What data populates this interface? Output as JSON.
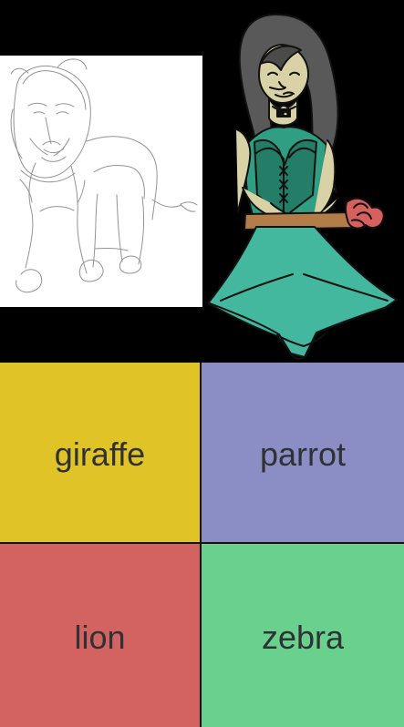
{
  "colors": {
    "background": "#000000",
    "yellow": "#e0c427",
    "purple": "#8b8ec4",
    "red": "#d36360",
    "green": "#69d18d",
    "text": "#2f3135"
  },
  "images": {
    "sketch": {
      "icon": "lion-sketch"
    },
    "character": {
      "icon": "girl-with-rose"
    }
  },
  "answers": [
    {
      "label": "giraffe",
      "color": "#e0c427"
    },
    {
      "label": "parrot",
      "color": "#8b8ec4"
    },
    {
      "label": "lion",
      "color": "#d36360"
    },
    {
      "label": "zebra",
      "color": "#69d18d"
    }
  ]
}
